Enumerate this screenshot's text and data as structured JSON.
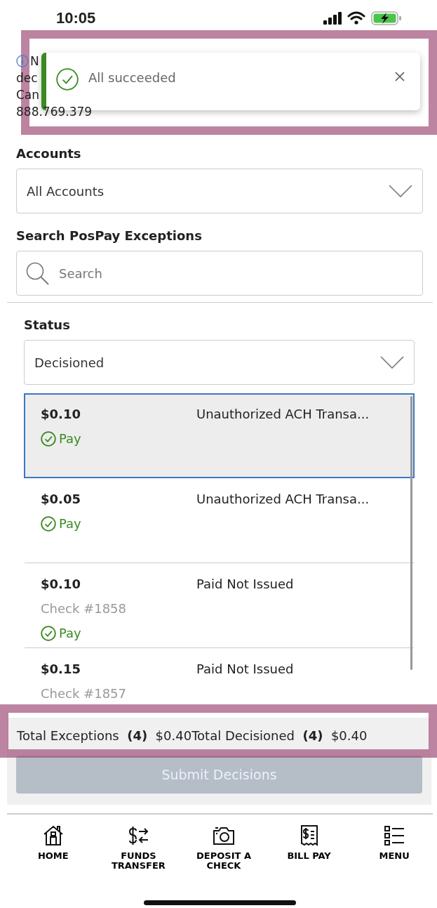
{
  "status_bar": {
    "time": "10:05"
  },
  "notice": {
    "lines": [
      "N",
      "dec",
      "Can",
      "888.769.379"
    ]
  },
  "toast": {
    "kind": "success",
    "message": "All succeeded"
  },
  "accounts": {
    "label": "Accounts",
    "value": "All Accounts"
  },
  "search": {
    "label": "Search PosPay Exceptions",
    "placeholder": "Search"
  },
  "status_filter": {
    "label": "Status",
    "value": "Decisioned"
  },
  "exceptions": [
    {
      "amount": "$0.10",
      "type": "Unauthorized ACH Transa...",
      "decision": "Pay",
      "selected": true
    },
    {
      "amount": "$0.05",
      "type": "Unauthorized ACH Transa...",
      "decision": "Pay",
      "selected": false
    },
    {
      "amount": "$0.10",
      "check": "Check #1858",
      "type": "Paid Not Issued",
      "decision": "Pay",
      "selected": false
    },
    {
      "amount": "$0.15",
      "check": "Check #1857",
      "type": "Paid Not Issued",
      "selected": false
    }
  ],
  "totals": [
    {
      "label": "Total Exceptions",
      "count": "(4)",
      "amount": "$0.40"
    },
    {
      "label": "Total Decisioned",
      "count": "(4)",
      "amount": "$0.40"
    }
  ],
  "submit": {
    "label": "Submit Decisions",
    "disabled": true
  },
  "tabs": [
    {
      "kind": "home",
      "label": "HOME"
    },
    {
      "kind": "transfer",
      "label": "FUNDS TRANSFER"
    },
    {
      "kind": "camera",
      "label": "DEPOSIT A CHECK"
    },
    {
      "kind": "bill",
      "label": "BILL PAY"
    },
    {
      "kind": "menu",
      "label": "MENU"
    }
  ]
}
